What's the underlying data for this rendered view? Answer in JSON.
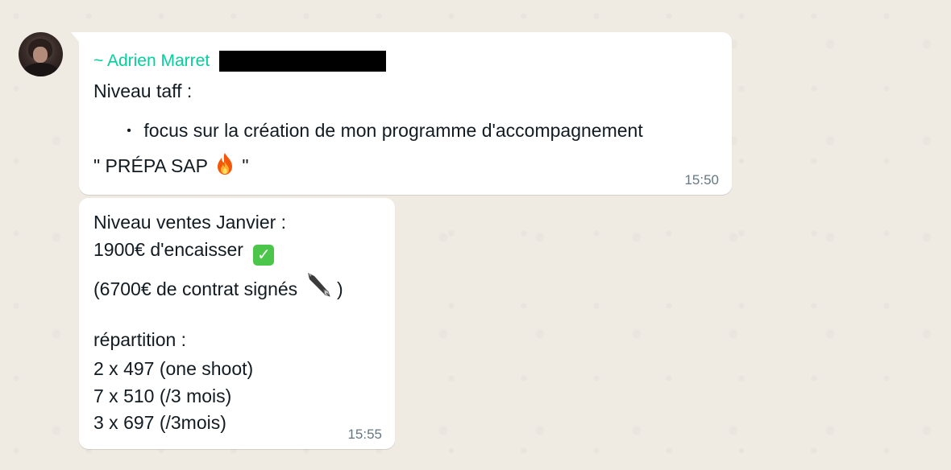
{
  "chat": {
    "messages": [
      {
        "sender": "~ Adrien Marret",
        "line1": "Niveau taff :",
        "bullet_char": "•",
        "bullet_text": "focus sur la création de mon programme d'accompagnement",
        "line3_before": "\" PRÉPA SAP ",
        "line3_after": " \"",
        "time": "15:50"
      },
      {
        "line1": "Niveau ventes Janvier :",
        "line2": "1900€ d'encaisser ",
        "check_symbol": "✓",
        "line3_before": "(6700€ de contrat signés ",
        "line3_after": ")",
        "line5": "répartition :",
        "line6": "2 x 497 (one shoot)",
        "line7": "7 x 510 (/3 mois)",
        "line8": "3 x 697 (/3mois)",
        "time": "15:55"
      }
    ]
  },
  "icons": {
    "fire": "fire-emoji-icon",
    "check": "check-mark-button-icon",
    "pen": "fountain-pen-icon"
  },
  "colors": {
    "background": "#efeae2",
    "sender_name": "#06cf9c",
    "timestamp": "#667781",
    "check_green": "#4cc64a",
    "redaction": "#000000"
  }
}
